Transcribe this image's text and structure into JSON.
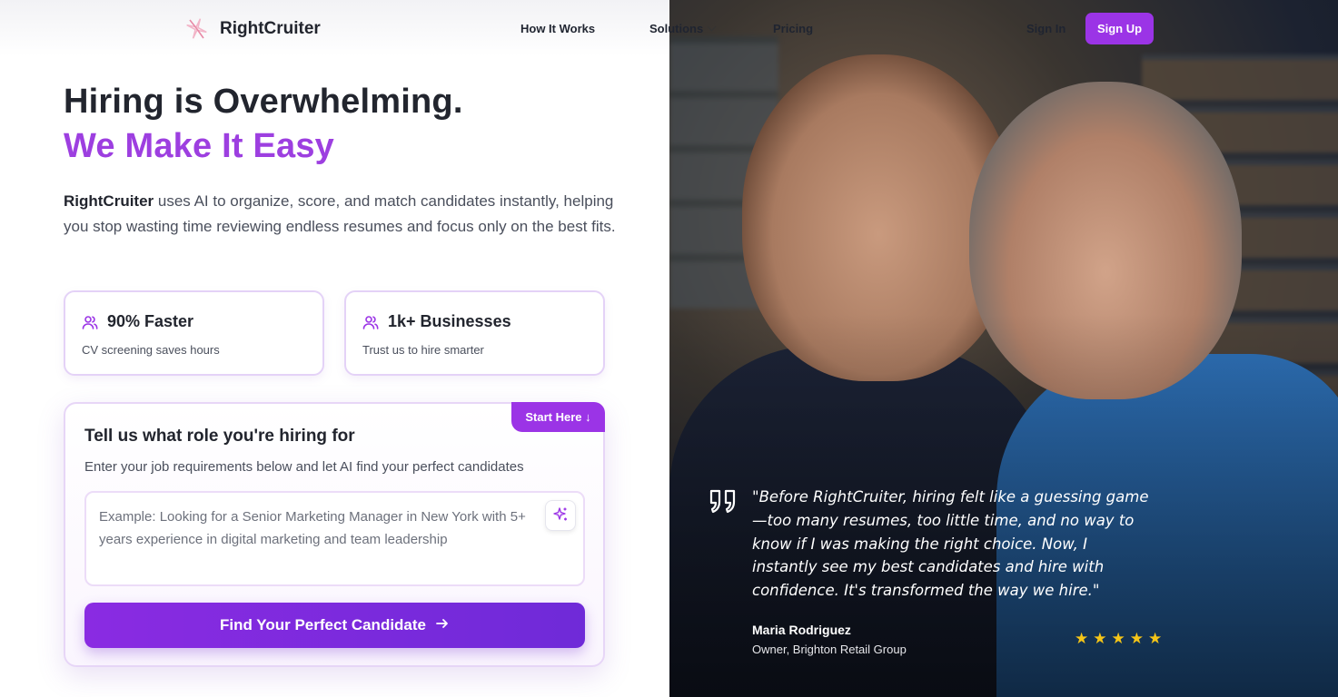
{
  "brand": {
    "name": "RightCruiter",
    "accent": "#9b34e6"
  },
  "nav": {
    "how_it_works": "How It Works",
    "solutions": "Solutions",
    "pricing": "Pricing",
    "sign_in": "Sign In",
    "sign_up": "Sign Up"
  },
  "hero": {
    "title_line1": "Hiring is Overwhelming.",
    "title_line2": "We Make It Easy",
    "lead_brand": "RightCruiter",
    "lead_rest": " uses AI to organize, score, and match candidates instantly, helping you stop wasting time reviewing endless resumes and focus only on the best fits."
  },
  "stats": [
    {
      "icon": "users-icon",
      "title": "90% Faster",
      "subtitle": "CV screening saves hours"
    },
    {
      "icon": "users-icon",
      "title": "1k+ Businesses",
      "subtitle": "Trust us to hire smarter"
    }
  ],
  "role_form": {
    "badge": "Start Here ↓",
    "heading": "Tell us what role you're hiring for",
    "subheading": "Enter your job requirements below and let AI find your perfect candidates",
    "placeholder": "Example: Looking for a Senior Marketing Manager in New York with 5+ years experience in digital marketing and team leadership",
    "value": "",
    "submit_label": "Find Your Perfect Candidate"
  },
  "testimonial": {
    "quote": "\"Before RightCruiter, hiring felt like a guessing game—too many resumes, too little time, and no way to know if I was making the right choice. Now, I instantly see my best candidates and hire with confidence. It's transformed the way we hire.\"",
    "author": "Maria Rodriguez",
    "role": "Owner, Brighton Retail Group",
    "rating": 5,
    "star_color": "#f5c518"
  }
}
